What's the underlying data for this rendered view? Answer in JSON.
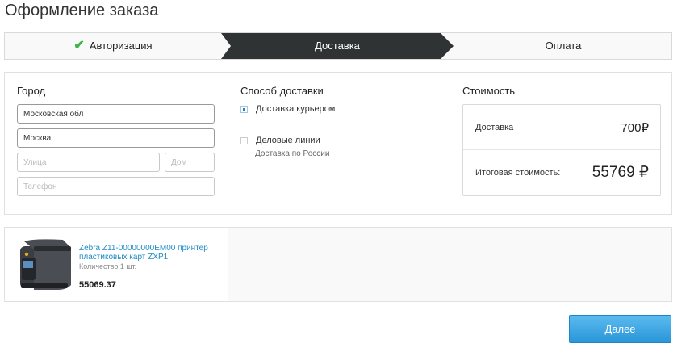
{
  "page_title": "Оформление заказа",
  "steps": {
    "auth": "Авторизация",
    "delivery": "Доставка",
    "payment": "Оплата",
    "active_color": "#2f3333",
    "done_color": "#3cb44a"
  },
  "city": {
    "title": "Город",
    "region_value": "Московская обл",
    "city_value": "Москва",
    "street_placeholder": "Улица",
    "house_placeholder": "Дом",
    "phone_placeholder": "Телефон"
  },
  "delivery_method": {
    "title": "Способ доставки",
    "options": [
      {
        "label": "Доставка курьером",
        "checked": true
      },
      {
        "label": "Деловые линии",
        "sub": "Доставка по России",
        "checked": false
      }
    ]
  },
  "cost": {
    "title": "Стоимость",
    "delivery_label": "Доставка",
    "delivery_value": "700₽",
    "total_label": "Итоговая стоимость:",
    "total_value": "55769 ₽"
  },
  "product": {
    "name": "Zebra Z11-00000000EM00 принтер пластиковых карт ZXP1",
    "quantity": "Количество 1 шт.",
    "price": "55069.37"
  },
  "next_button": "Далее",
  "accent_color": "#2a95d8"
}
